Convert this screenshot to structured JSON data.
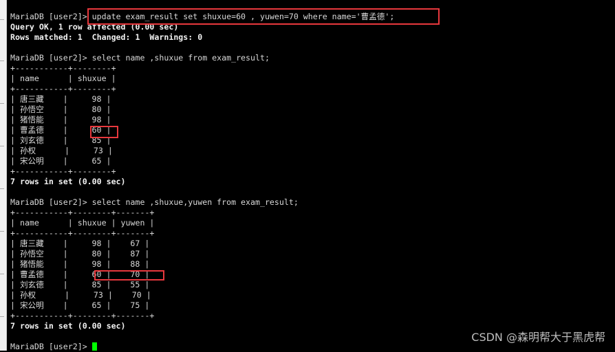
{
  "prompt": "MariaDB [user2]> ",
  "commands": [
    "update exam_result set shuxue=60 , yuwen=70 where name='曹孟德';",
    "select name ,shuxue from exam_result;",
    "select name ,shuxue,yuwen from exam_result;"
  ],
  "update_result": {
    "line1": "Query OK, 1 row affected (0.00 sec)",
    "line2": "Rows matched: 1  Changed: 1  Warnings: 0"
  },
  "table1": {
    "columns": [
      "name",
      "shuxue"
    ],
    "rows": [
      [
        "唐三藏",
        98
      ],
      [
        "孙悟空",
        80
      ],
      [
        "猪悟能",
        98
      ],
      [
        "曹孟德",
        60
      ],
      [
        "刘玄德",
        85
      ],
      [
        "孙权",
        73
      ],
      [
        "宋公明",
        65
      ]
    ],
    "footer": "7 rows in set (0.00 sec)"
  },
  "table2": {
    "columns": [
      "name",
      "shuxue",
      "yuwen"
    ],
    "rows": [
      [
        "唐三藏",
        98,
        67
      ],
      [
        "孙悟空",
        80,
        87
      ],
      [
        "猪悟能",
        98,
        88
      ],
      [
        "曹孟德",
        60,
        70
      ],
      [
        "刘玄德",
        85,
        55
      ],
      [
        "孙权",
        73,
        70
      ],
      [
        "宋公明",
        65,
        75
      ]
    ],
    "footer": "7 rows in set (0.00 sec)"
  },
  "highlight_color": "#e8383d",
  "cursor_color": "#00ff00",
  "watermark": "CSDN @森明帮大于黑虎帮"
}
